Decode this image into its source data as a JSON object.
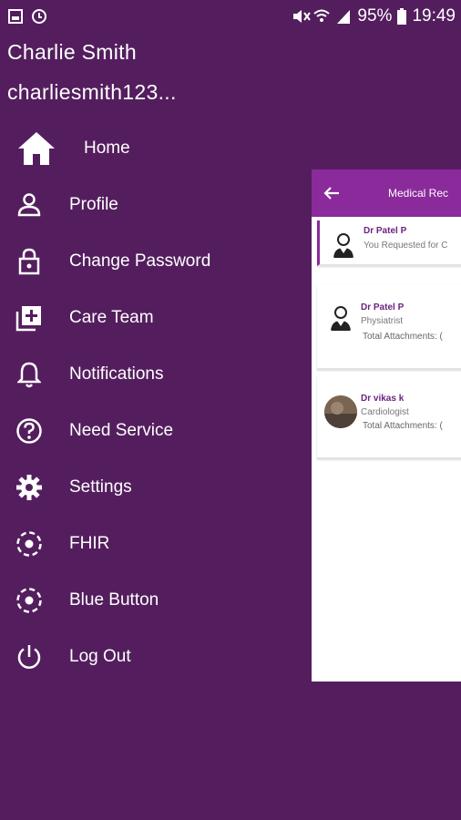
{
  "status_bar": {
    "left_icons": [
      "image-icon",
      "sync-icon"
    ],
    "right_icons": [
      "mute-icon",
      "wifi-icon",
      "signal-icon"
    ],
    "battery": "95%",
    "time": "19:49"
  },
  "drawer": {
    "user_name": "Charlie Smith",
    "user_id": "charliesmith123...",
    "items": [
      {
        "label": "Home",
        "icon": "home-icon"
      },
      {
        "label": "Profile",
        "icon": "person-icon"
      },
      {
        "label": "Change Password",
        "icon": "lock-icon"
      },
      {
        "label": "Care Team",
        "icon": "add-box-icon"
      },
      {
        "label": "Notifications",
        "icon": "bell-icon"
      },
      {
        "label": "Need Service",
        "icon": "help-circle-icon"
      },
      {
        "label": "Settings",
        "icon": "gear-icon"
      },
      {
        "label": "FHIR",
        "icon": "dashed-circle-icon"
      },
      {
        "label": "Blue Button",
        "icon": "dashed-circle-icon"
      },
      {
        "label": "Log Out",
        "icon": "power-icon"
      }
    ]
  },
  "panel": {
    "title": "Medical Rec",
    "cards": [
      {
        "doctor": "Dr Patel P",
        "subtitle": "You Requested for C",
        "attachments": ""
      },
      {
        "doctor": "Dr Patel P",
        "subtitle": "Physiatrist",
        "attachments": "Total Attachments: ("
      },
      {
        "doctor": "Dr vikas k",
        "subtitle": "Cardiologist",
        "attachments": "Total Attachments: ("
      }
    ]
  },
  "colors": {
    "background": "#541e5e",
    "panel_header": "#8a2a9b",
    "doctor_name": "#6b2380"
  }
}
